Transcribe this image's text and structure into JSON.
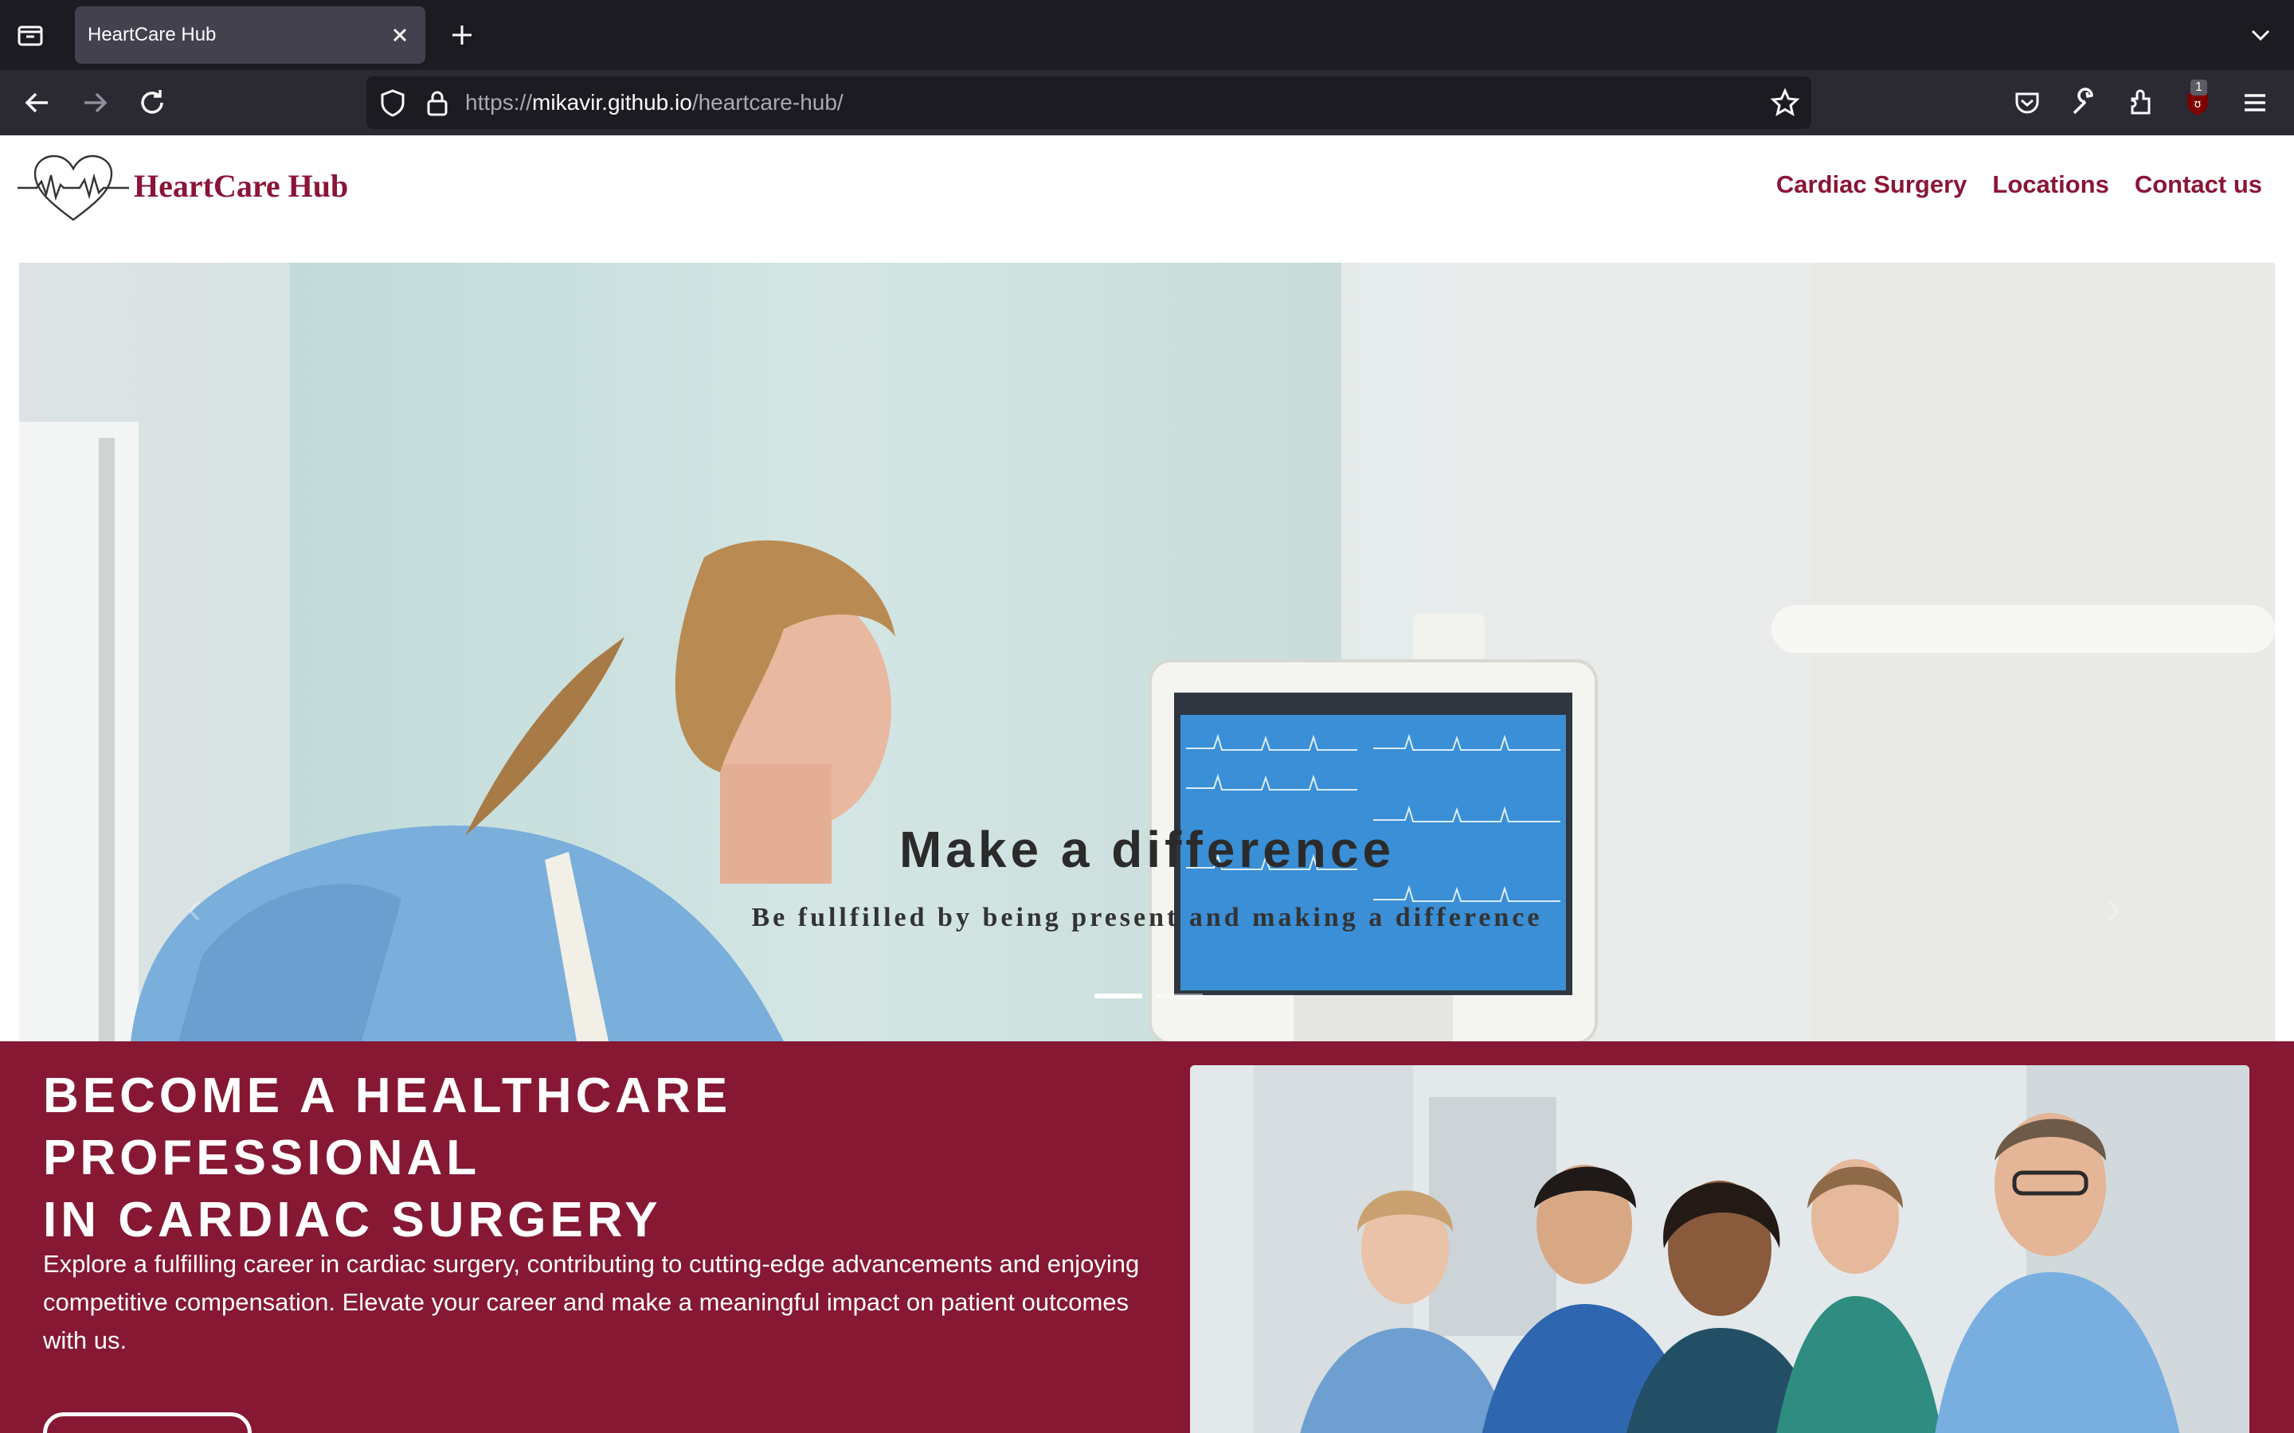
{
  "browser": {
    "tab_title": "HeartCare Hub",
    "url_prefix": "https://",
    "url_domain": "mikavir.github.io",
    "url_path": "/heartcare-hub/",
    "extension_badge": "1",
    "theme_colors": {
      "tabbar": "#1c1b22",
      "toolbar": "#2b2a33",
      "tab_active": "#42414d"
    }
  },
  "site": {
    "logo_text": "HeartCare Hub",
    "brand_color": "#8a1538",
    "nav": [
      "Cardiac Surgery",
      "Locations",
      "Contact us"
    ]
  },
  "hero": {
    "title": "Make a difference",
    "subtitle": "Be fullfilled by being present and making a difference",
    "slide_count": 2,
    "active_slide": 1
  },
  "career": {
    "title_line1": "BECOME A HEALTHCARE PROFESSIONAL",
    "title_line2": "IN CARDIAC SURGERY",
    "text": "Explore a fulfilling career in cardiac surgery, contributing to cutting-edge advancements and enjoying competitive compensation. Elevate your career and make a meaningful impact on patient outcomes with us.",
    "background": "#861833"
  }
}
